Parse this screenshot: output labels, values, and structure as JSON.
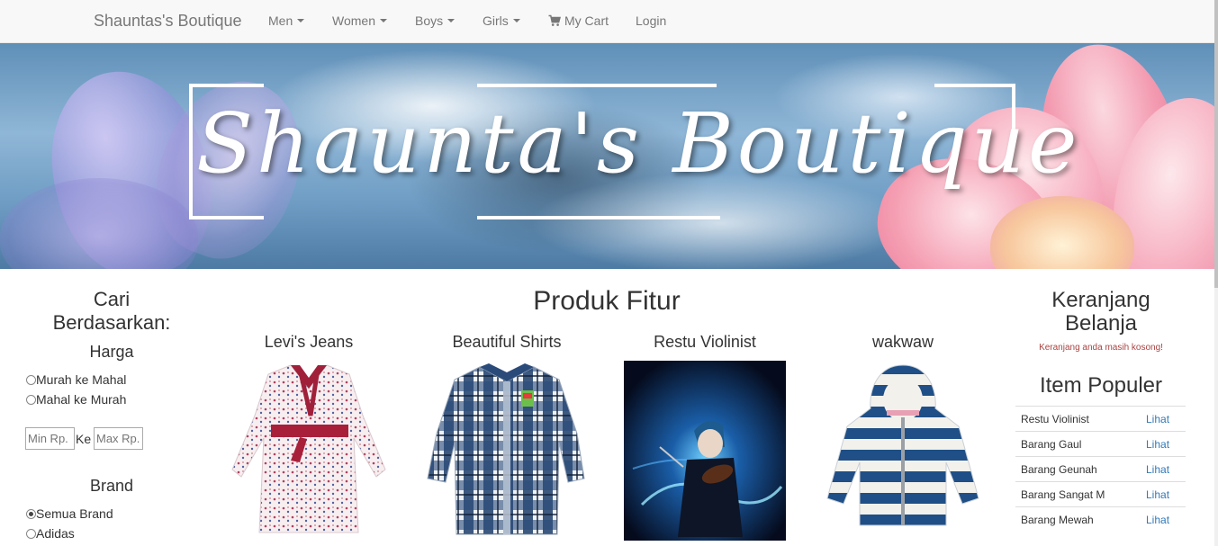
{
  "navbar": {
    "brand": "Shauntas's Boutique",
    "items": [
      {
        "label": "Men",
        "dropdown": true
      },
      {
        "label": "Women",
        "dropdown": true
      },
      {
        "label": "Boys",
        "dropdown": true
      },
      {
        "label": "Girls",
        "dropdown": true
      }
    ],
    "cart_label": "My Cart",
    "cart_icon": "shopping-cart-icon",
    "login_label": "Login"
  },
  "banner": {
    "title": "Shaunta's Boutique"
  },
  "left_sidebar": {
    "heading_line1": "Cari",
    "heading_line2": "Berdasarkan:",
    "price_heading": "Harga",
    "sort_options": [
      {
        "label": "Murah ke Mahal",
        "checked": false
      },
      {
        "label": "Mahal ke Murah",
        "checked": false
      }
    ],
    "min_placeholder": "Min Rp.",
    "separator": "Ke",
    "max_placeholder": "Max Rp.",
    "brand_heading": "Brand",
    "brand_options": [
      {
        "label": "Semua Brand",
        "checked": true
      },
      {
        "label": "Adidas",
        "checked": false
      }
    ]
  },
  "main": {
    "title": "Produk Fitur",
    "products": [
      {
        "name": "Levi's Jeans",
        "image": "floral-dress-image"
      },
      {
        "name": "Beautiful Shirts",
        "image": "plaid-shirt-image"
      },
      {
        "name": "Restu Violinist",
        "image": "anime-violinist-image"
      },
      {
        "name": "wakwaw",
        "image": "striped-hoodie-image"
      }
    ]
  },
  "right_sidebar": {
    "cart_title_line1": "Keranjang",
    "cart_title_line2": "Belanja",
    "cart_empty": "Keranjang anda masih kosong!",
    "popular_title": "Item Populer",
    "popular_items": [
      {
        "name": "Restu Violinist",
        "link": "Lihat"
      },
      {
        "name": "Barang Gaul",
        "link": "Lihat"
      },
      {
        "name": "Barang Geunah",
        "link": "Lihat"
      },
      {
        "name": "Barang Sangat M",
        "link": "Lihat"
      },
      {
        "name": "Barang Mewah",
        "link": "Lihat"
      }
    ]
  },
  "colors": {
    "navbar_bg": "#f8f8f8",
    "nav_text": "#777777",
    "link": "#337ab7",
    "empty_note": "#a94442"
  }
}
